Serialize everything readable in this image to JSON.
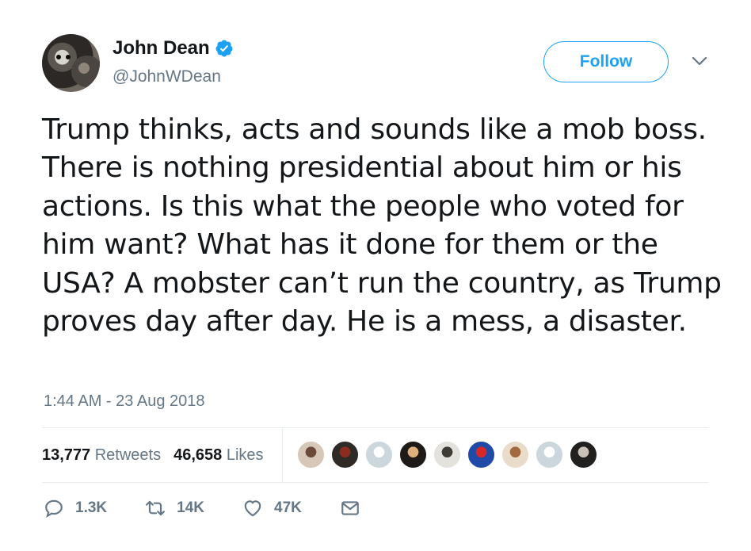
{
  "author": {
    "name": "John Dean",
    "handle": "@JohnWDean",
    "verified": true,
    "avatar_icon": "dog-photo-avatar"
  },
  "follow_button": {
    "label": "Follow"
  },
  "menu": {
    "icon": "chevron-down-icon"
  },
  "tweet": {
    "text": "Trump thinks, acts and sounds like a mob boss. There is nothing presidential about him or his actions. Is this what the people who voted for him want? What has it done for them or the USA? A mobster can’t run the country, as Trump proves day after day. He is a mess, a disaster.",
    "timestamp": "1:44 AM - 23 Aug 2018"
  },
  "stats": {
    "retweets_count": "13,777",
    "retweets_label": "Retweets",
    "likes_count": "46,658",
    "likes_label": "Likes"
  },
  "liker_avatars": [
    {
      "name": "liker-avatar-1",
      "bg": "#d6c7b8",
      "fg": "#6b4a3a"
    },
    {
      "name": "liker-avatar-2",
      "bg": "#2f2a26",
      "fg": "#8a2d1f"
    },
    {
      "name": "liker-avatar-3",
      "bg": "#ccd6dd",
      "fg": "#ffffff"
    },
    {
      "name": "liker-avatar-4",
      "bg": "#1d1a17",
      "fg": "#e0b07a"
    },
    {
      "name": "liker-avatar-5",
      "bg": "#e4e2dd",
      "fg": "#3e3a34"
    },
    {
      "name": "liker-avatar-6",
      "bg": "#1f4aa8",
      "fg": "#d62828"
    },
    {
      "name": "liker-avatar-7",
      "bg": "#e9dccb",
      "fg": "#a36a3f"
    },
    {
      "name": "liker-avatar-8",
      "bg": "#ccd6dd",
      "fg": "#ffffff"
    },
    {
      "name": "liker-avatar-9",
      "bg": "#22201e",
      "fg": "#c9c1b6"
    }
  ],
  "actions": {
    "reply_count": "1.3K",
    "retweet_count": "14K",
    "like_count": "47K",
    "dm_icon": "envelope-icon"
  },
  "colors": {
    "accent": "#1da1f2",
    "text": "#14171a",
    "secondary": "#657786",
    "divider": "#e6ecf0"
  }
}
